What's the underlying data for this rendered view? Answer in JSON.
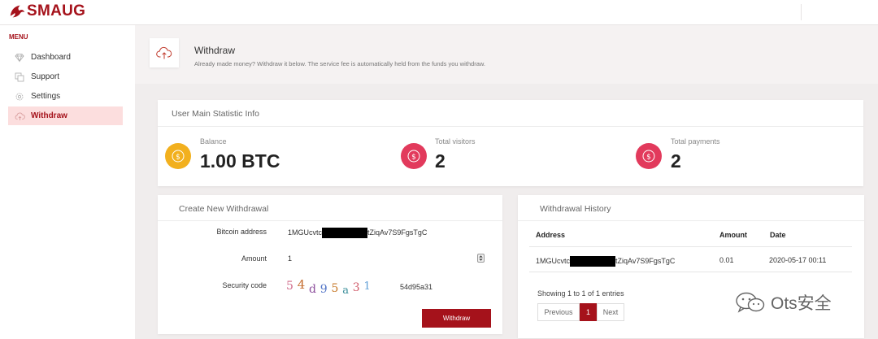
{
  "app": {
    "logo_text": "SMAUG"
  },
  "sidebar": {
    "menu_title": "MENU",
    "items": [
      {
        "label": "Dashboard",
        "icon": "diamond-icon"
      },
      {
        "label": "Support",
        "icon": "copy-icon"
      },
      {
        "label": "Settings",
        "icon": "gear-icon"
      },
      {
        "label": "Withdraw",
        "icon": "cloud-upload-icon",
        "active": true
      }
    ]
  },
  "header": {
    "title": "Withdraw",
    "subtitle": "Already made money? Withdraw it below. The service fee is automatically held from the funds you withdraw."
  },
  "stats": {
    "title": "User Main Statistic Info",
    "items": [
      {
        "label": "Balance",
        "value": "1.00 BTC",
        "color": "#f2b01e"
      },
      {
        "label": "Total visitors",
        "value": "2",
        "color": "#e23a5c"
      },
      {
        "label": "Total payments",
        "value": "2",
        "color": "#e23a5c"
      }
    ]
  },
  "withdraw_form": {
    "title": "Create New Withdrawal",
    "bitcoin_label": "Bitcoin address",
    "bitcoin_prefix": "1MGUcvtc",
    "bitcoin_suffix": "tZiqAv7S9FgsTgC",
    "amount_label": "Amount",
    "amount_value": "1",
    "security_label": "Security code",
    "captcha_chars": [
      "5",
      "4",
      "d",
      "9",
      "5",
      "a",
      "3",
      "1"
    ],
    "security_value": "54d95a31",
    "button_label": "Withdraw"
  },
  "history": {
    "title": "Withdrawal History",
    "columns": [
      "Address",
      "Amount",
      "Date"
    ],
    "rows": [
      {
        "address_prefix": "1MGUcvtc",
        "address_suffix": "tZiqAv7S9FgsTgC",
        "amount": "0.01",
        "date": "2020-05-17 00:11"
      }
    ],
    "info": "Showing 1 to 1 of 1 entries",
    "pagination": {
      "previous": "Previous",
      "current": "1",
      "next": "Next"
    }
  },
  "watermark": {
    "text": "Ots安全"
  },
  "colors": {
    "brand": "#a5121b",
    "active_bg": "#fcdede",
    "gold": "#f2b01e",
    "pink": "#e23a5c"
  }
}
